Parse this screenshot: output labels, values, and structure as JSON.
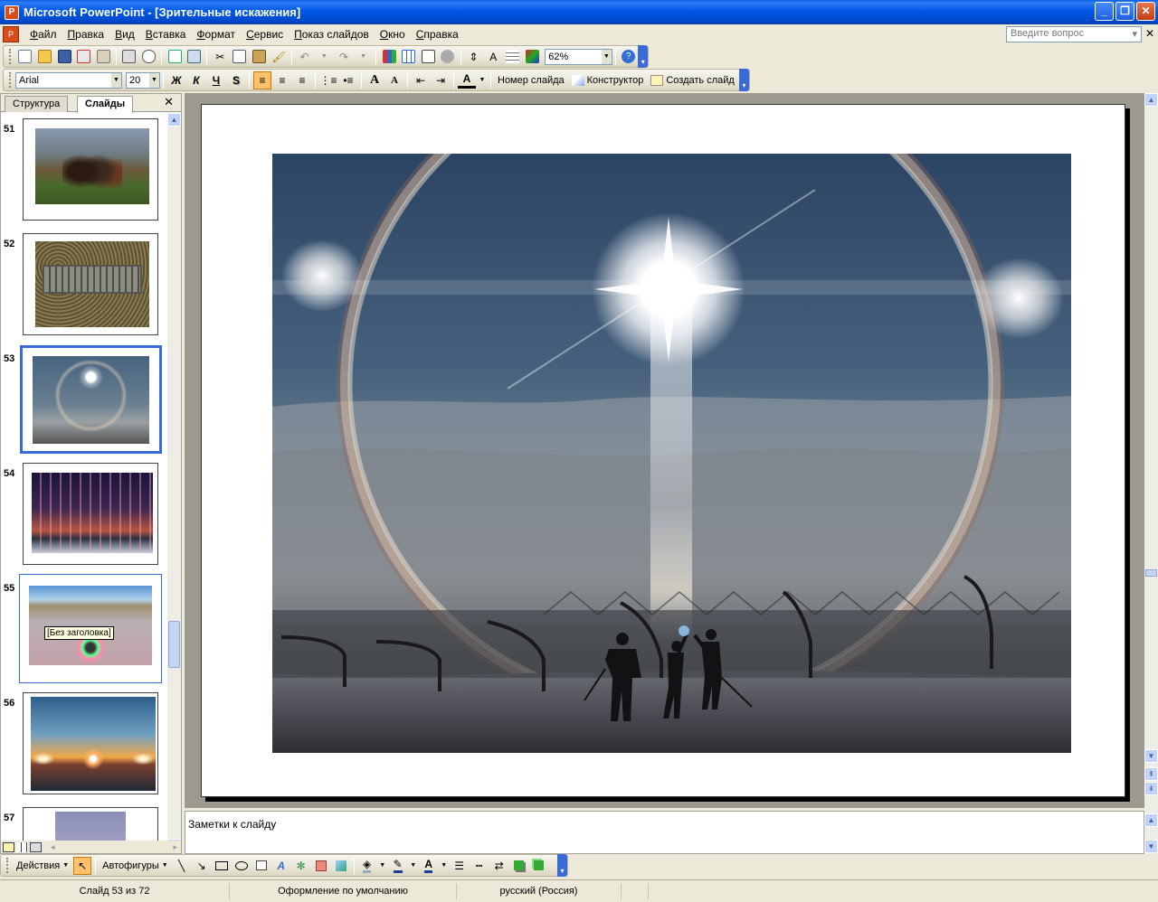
{
  "window": {
    "title": "Microsoft PowerPoint - [Зрительные искажения]",
    "app_icon": "powerpoint-icon",
    "controls": [
      "minimize-icon",
      "restore-icon",
      "close-icon"
    ]
  },
  "menu": {
    "items": [
      "Файл",
      "Правка",
      "Вид",
      "Вставка",
      "Формат",
      "Сервис",
      "Показ слайдов",
      "Окно",
      "Справка"
    ],
    "ask_placeholder": "Введите вопрос"
  },
  "standard_toolbar": {
    "zoom": "62%",
    "icons": [
      "new-icon",
      "open-icon",
      "save-icon",
      "permission-icon",
      "email-icon",
      "print-icon",
      "preview-icon",
      "spelling-icon",
      "research-icon",
      "cut-icon",
      "copy-icon",
      "paste-icon",
      "format-painter-icon",
      "undo-icon",
      "redo-icon",
      "insert-chart-icon",
      "insert-table-icon",
      "tables-borders-icon",
      "hyperlink-icon",
      "expand-icon",
      "show-formatting-icon",
      "grid-icon",
      "grayscale-icon",
      "help-icon"
    ]
  },
  "format_toolbar": {
    "font": "Arial",
    "size": "20",
    "bold": "Ж",
    "italic": "К",
    "underline": "Ч",
    "shadow": "S",
    "grow_font": "A",
    "shrink_font": "A",
    "font_color_letter": "A",
    "slide_number_label": "Номер слайда",
    "designer_label": "Конструктор",
    "new_slide_label": "Создать слайд"
  },
  "left_pane": {
    "tab_outline": "Структура",
    "tab_slides": "Слайды",
    "selected_slide": "53",
    "thumbnails": [
      {
        "num": "51",
        "scene": "bogatyrs-painting"
      },
      {
        "num": "52",
        "scene": "bench-illusion"
      },
      {
        "num": "53",
        "scene": "sun-halo"
      },
      {
        "num": "54",
        "scene": "light-pillars"
      },
      {
        "num": "55",
        "scene": "glory-fog"
      },
      {
        "num": "56",
        "scene": "sundogs-sunset"
      },
      {
        "num": "57",
        "scene": "sky-partial"
      }
    ],
    "tooltip": "[Без заголовка]"
  },
  "notes": {
    "placeholder": "Заметки к слайду"
  },
  "drawing_toolbar": {
    "actions_label": "Действия",
    "autoshapes_label": "Автофигуры"
  },
  "status": {
    "slide": "Слайд 53 из 72",
    "design": "Оформление по умолчанию",
    "language": "русский (Россия)"
  },
  "colors": {
    "title_blue": "#0054e3",
    "selection_blue": "#3a6ad6",
    "chrome": "#ece9d8"
  }
}
